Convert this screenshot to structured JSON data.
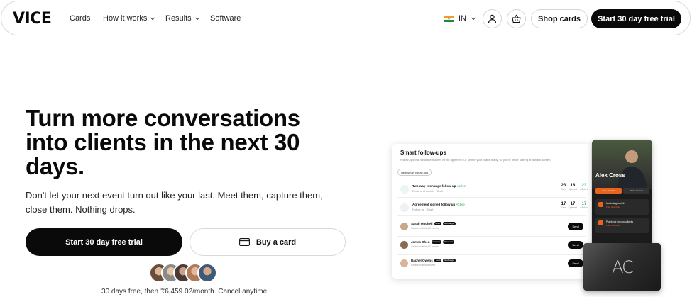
{
  "nav": {
    "logo": "VICE",
    "links": [
      "Cards",
      "How it works",
      "Results",
      "Software"
    ],
    "country": "IN",
    "shop_label": "Shop cards",
    "trial_label": "Start 30 day free trial"
  },
  "hero": {
    "headline": "Turn more conversations into clients in the next 30 days.",
    "subtext": "Don't let your next event turn out like your last. Meet them, capture them, close them. Nothing drops.",
    "cta_primary": "Start 30 day free trial",
    "cta_secondary": "Buy a card",
    "pricing": "30 days free, then ₹6,459.02/month. Cancel anytime."
  },
  "dashboard": {
    "title": "Smart follow-ups",
    "subtitle": "Follow-ups that send themselves at the right time. Or sent in your drafts ready, so you're never staring at a blank screen.",
    "pill": "New smart follow-ups",
    "followups": [
      {
        "name": "Two way exchange follow up",
        "status": "Active",
        "meta": "Email and socials · Draft",
        "stats": [
          {
            "v": "23",
            "l": "Sent"
          },
          {
            "v": "18",
            "l": "Opened"
          },
          {
            "v": "23",
            "l": "Clicked"
          }
        ]
      },
      {
        "name": "Agreement signed follow up",
        "status": "Active",
        "meta": "Follow up · Draft",
        "stats": [
          {
            "v": "17",
            "l": "Sent"
          },
          {
            "v": "17",
            "l": "Opened"
          },
          {
            "v": "17",
            "l": "Clicked"
          }
        ]
      }
    ],
    "contacts": [
      {
        "name": "Sarah Mitchell",
        "tags": [
          "Lead",
          "Exchange"
        ],
        "desc": "Captured at last 3 events",
        "send": "Send"
      },
      {
        "name": "James Chen",
        "tags": [
          "Contact",
          "Prospect"
        ],
        "desc": "Captured at last 2 events",
        "send": "Send"
      },
      {
        "name": "Rachel Owens",
        "tags": [
          "Lead",
          "Exchange"
        ],
        "desc": "Captured at last event",
        "send": "Send"
      }
    ]
  },
  "phone": {
    "name": "Alex Cross",
    "btn1": "Save Contact",
    "btn2": "Share Contact",
    "items": [
      {
        "title": "Marketing toolkit",
        "sub": "Free download"
      },
      {
        "title": "Playbook for consultants",
        "sub": "Free download"
      }
    ]
  },
  "card": {
    "logo": "AC"
  },
  "colors": {
    "primary": "#0a0a0a",
    "accent": "#e8641c",
    "active": "#2aa855"
  }
}
